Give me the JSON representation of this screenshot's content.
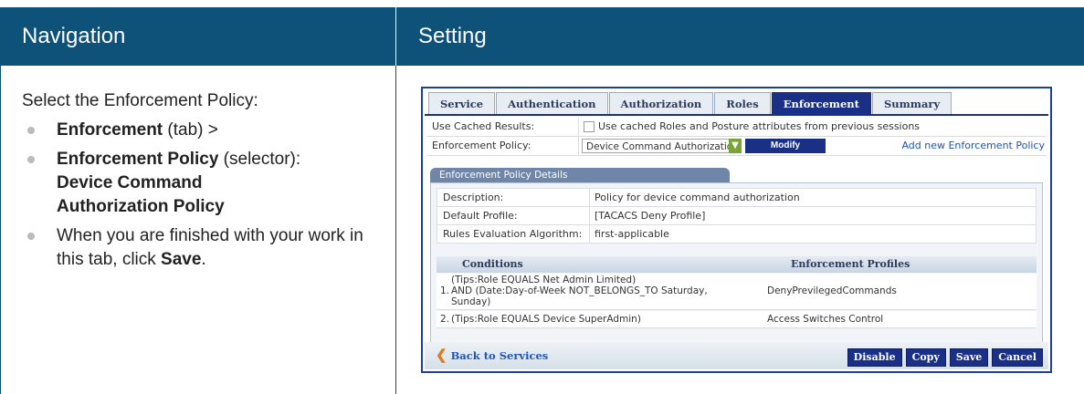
{
  "headers": {
    "navigation": "Navigation",
    "setting": "Setting"
  },
  "nav": {
    "intro": "Select the Enforcement Policy:",
    "items": [
      {
        "bold": "Enforcement",
        "rest": " (tab) >"
      },
      {
        "bold": "Enforcement Policy",
        "rest": " (selector):"
      },
      {
        "pre": "When you are finished with your work in this tab, click ",
        "bold": "Save",
        "post": "."
      }
    ],
    "policy_name_line1": "Device Command",
    "policy_name_line2": "Authorization Policy"
  },
  "screenshot": {
    "tabs": [
      {
        "label": "Service",
        "active": false
      },
      {
        "label": "Authentication",
        "active": false
      },
      {
        "label": "Authorization",
        "active": false
      },
      {
        "label": "Roles",
        "active": false
      },
      {
        "label": "Enforcement",
        "active": true
      },
      {
        "label": "Summary",
        "active": false
      }
    ],
    "use_cached": {
      "label": "Use Cached Results:",
      "checkbox_text": "Use cached Roles and Posture attributes from previous sessions"
    },
    "policy": {
      "label": "Enforcement Policy:",
      "selected": "Device Command Authorization Policy",
      "modify": "Modify",
      "add_link": "Add new Enforcement Policy"
    },
    "details_title": "Enforcement Policy Details",
    "details": [
      {
        "label": "Description:",
        "value": "Policy for device command authorization"
      },
      {
        "label": "Default Profile:",
        "value": "[TACACS Deny Profile]"
      },
      {
        "label": "Rules Evaluation Algorithm:",
        "value": "first-applicable"
      }
    ],
    "conditions_header": "Conditions",
    "profiles_header": "Enforcement Profiles",
    "rules": [
      {
        "num": "1.",
        "line1": "(Tips:Role EQUALS Net Admin Limited)",
        "line2": "AND (Date:Day-of-Week NOT_BELONGS_TO Saturday,",
        "line3": "Sunday)",
        "profile": "DenyPrevilegedCommands"
      },
      {
        "num": "2.",
        "line1": "(Tips:Role EQUALS Device SuperAdmin)",
        "profile": "Access Switches Control"
      }
    ],
    "back": "Back to Services",
    "buttons": {
      "disable": "Disable",
      "copy": "Copy",
      "save": "Save",
      "cancel": "Cancel"
    }
  }
}
